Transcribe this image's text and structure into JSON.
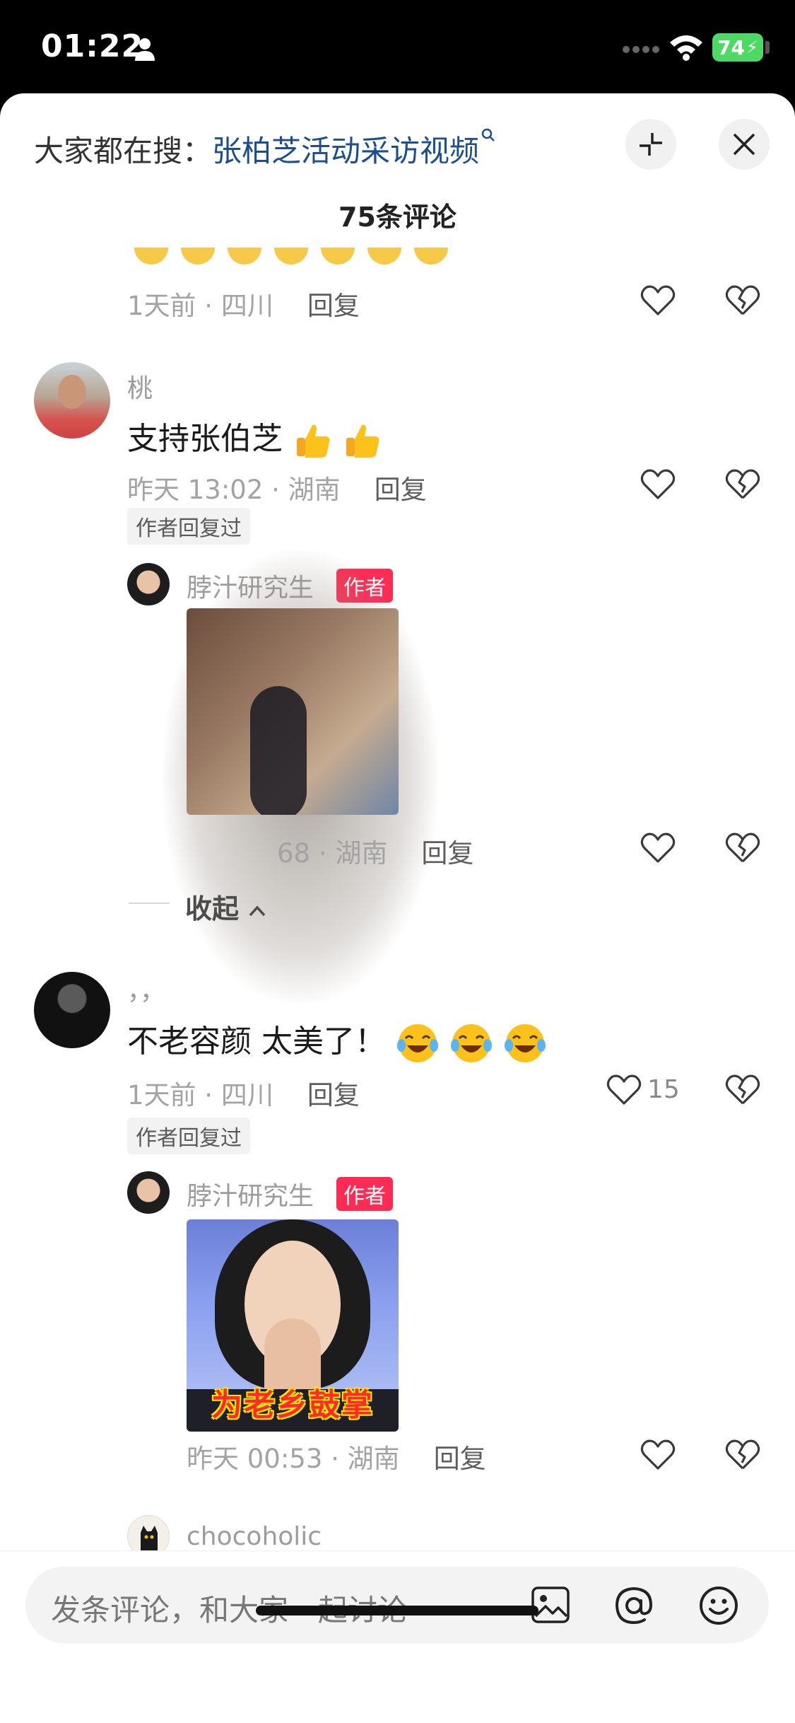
{
  "status_bar": {
    "time": "01:22",
    "battery": "74"
  },
  "header": {
    "search_prefix": "大家都在搜：",
    "search_keyword": "张柏芝活动采访视频",
    "comment_count": "75条评论"
  },
  "comments": [
    {
      "meta_time": "1天前 · 四川",
      "reply_label": "回复"
    },
    {
      "user": "桃",
      "text": "支持张伯芝",
      "meta_time": "昨天 13:02 · 湖南",
      "reply_label": "回复",
      "author_replied": "作者回复过",
      "sub_reply": {
        "user": "脖汁研究生",
        "tag": "作者",
        "meta_time": "68 · 湖南",
        "reply_label": "回复"
      },
      "collapse_label": "收起"
    },
    {
      "user": "，，",
      "text": "不老容颜 太美了！",
      "meta_time": "1天前 · 四川",
      "reply_label": "回复",
      "like_count": "15",
      "author_replied": "作者回复过",
      "sub_reply": {
        "user": "脖汁研究生",
        "tag": "作者",
        "image_caption": "为老乡鼓掌",
        "meta_time": "昨天 00:53 · 湖南",
        "reply_label": "回复"
      }
    },
    {
      "user": "chocoholic"
    }
  ],
  "input": {
    "placeholder": "发条评论，和大家一起讨论"
  },
  "colors": {
    "accent": "#fe2c55",
    "link": "#1e4f8c",
    "battery": "#4cd964"
  }
}
